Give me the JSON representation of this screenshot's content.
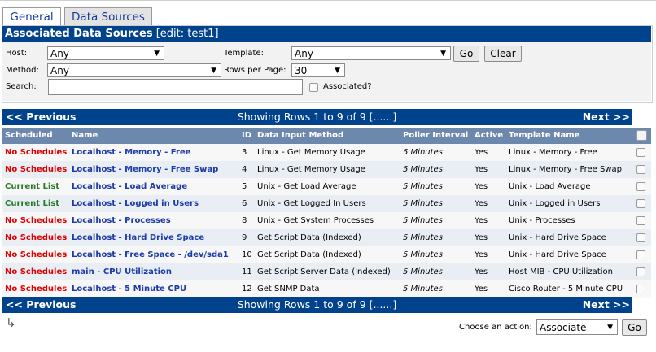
{
  "tabs": [
    "General",
    "Data Sources"
  ],
  "header": {
    "title": "Associated Data Sources",
    "edit": "[edit: test1]"
  },
  "filters": {
    "host_label": "Host:",
    "host_value": "Any",
    "template_label": "Template:",
    "template_value": "Any",
    "go_label": "Go",
    "clear_label": "Clear",
    "method_label": "Method:",
    "method_value": "Any",
    "rows_label": "Rows per Page:",
    "rows_value": "30",
    "search_label": "Search:",
    "search_value": "",
    "associated_label": "Associated?"
  },
  "nav": {
    "prev": "<< Previous",
    "showing": "Showing Rows 1 to 9 of 9 [......]",
    "next": "Next >>"
  },
  "columns": [
    "Scheduled",
    "Name",
    "ID",
    "Data Input Method",
    "Poller Interval",
    "Active",
    "Template Name"
  ],
  "rows": [
    {
      "scheduled": "No Schedules",
      "status": "none",
      "name": "Localhost - Memory - Free",
      "id": "3",
      "method": "Linux - Get Memory Usage",
      "interval": "5 Minutes",
      "active": "Yes",
      "template": "Linux - Memory - Free"
    },
    {
      "scheduled": "No Schedules",
      "status": "none",
      "name": "Localhost - Memory - Free Swap",
      "id": "4",
      "method": "Linux - Get Memory Usage",
      "interval": "5 Minutes",
      "active": "Yes",
      "template": "Linux - Memory - Free Swap"
    },
    {
      "scheduled": "Current List",
      "status": "current",
      "name": "Localhost - Load Average",
      "id": "5",
      "method": "Unix - Get Load Average",
      "interval": "5 Minutes",
      "active": "Yes",
      "template": "Unix - Load Average"
    },
    {
      "scheduled": "Current List",
      "status": "current",
      "name": "Localhost - Logged in Users",
      "id": "6",
      "method": "Unix - Get Logged In Users",
      "interval": "5 Minutes",
      "active": "Yes",
      "template": "Unix - Logged in Users"
    },
    {
      "scheduled": "No Schedules",
      "status": "none",
      "name": "Localhost - Processes",
      "id": "8",
      "method": "Unix - Get System Processes",
      "interval": "5 Minutes",
      "active": "Yes",
      "template": "Unix - Processes"
    },
    {
      "scheduled": "No Schedules",
      "status": "none",
      "name": "Localhost - Hard Drive Space",
      "id": "9",
      "method": "Get Script Data (Indexed)",
      "interval": "5 Minutes",
      "active": "Yes",
      "template": "Unix - Hard Drive Space"
    },
    {
      "scheduled": "No Schedules",
      "status": "none",
      "name": "Localhost - Free Space - /dev/sda1",
      "id": "10",
      "method": "Get Script Data (Indexed)",
      "interval": "5 Minutes",
      "active": "Yes",
      "template": "Unix - Hard Drive Space"
    },
    {
      "scheduled": "No Schedules",
      "status": "none",
      "name": "main - CPU Utilization",
      "id": "11",
      "method": "Get Script Server Data (Indexed)",
      "interval": "5 Minutes",
      "active": "Yes",
      "template": "Host MIB - CPU Utilization"
    },
    {
      "scheduled": "No Schedules",
      "status": "none",
      "name": "Localhost - 5 Minute CPU",
      "id": "12",
      "method": "Get SNMP Data",
      "interval": "5 Minutes",
      "active": "Yes",
      "template": "Cisco Router - 5 Minute CPU"
    }
  ],
  "footer": {
    "choose_label": "Choose an action:",
    "action_value": "Associate",
    "go_label": "Go"
  },
  "colors": {
    "header_blue": "#00438c",
    "column_header": "#6d88ad",
    "no_schedule": "#e00000",
    "current_list": "#2a7a2a",
    "link_blue": "#1c3ba8"
  }
}
